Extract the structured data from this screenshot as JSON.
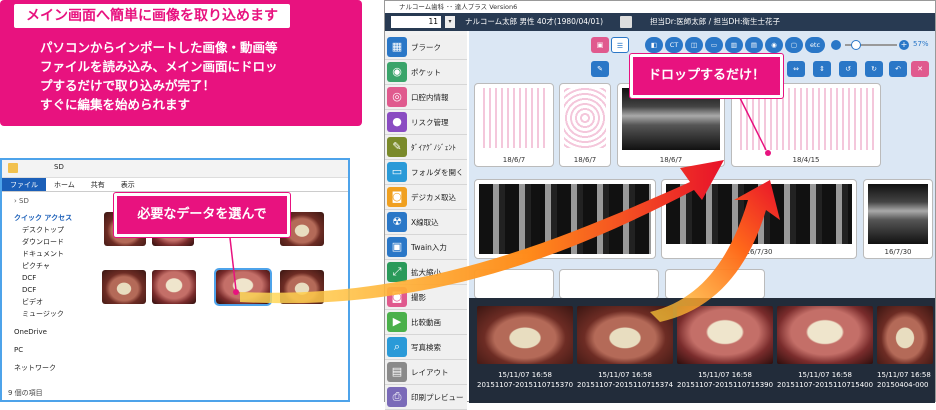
{
  "promo": {
    "title": "メイン画面へ簡単に画像を取り込めます",
    "lines": [
      "パソコンからインポートした画像・動画等",
      "ファイルを読み込み、メイン画面にドロッ",
      "プするだけで取り込みが完了！",
      "すぐに編集を始められます"
    ]
  },
  "explorer": {
    "title": "SD",
    "tabs": [
      "ファイル",
      "ホーム",
      "共有",
      "表示"
    ],
    "address": "SD",
    "nav": [
      "クイック アクセス",
      "デスクトップ",
      "ダウンロード",
      "ドキュメント",
      "ピクチャ",
      "DCF",
      "DCF",
      "ビデオ",
      "ミュージック",
      "OneDrive",
      "PC",
      "ネットワーク"
    ],
    "status": "9 個の項目"
  },
  "callouts": {
    "select": "必要なデータを選んで",
    "drop": "ドロップするだけ！"
  },
  "app": {
    "title": "ナルコーム歯科 ･･ 達人プラス Version6",
    "patient_id": "11",
    "patient_info": "ナルコーム太郎 男性 40才(1980/04/01)",
    "staff": "担当Dr:医師太郎 / 担当DH:衛生士花子",
    "zoom": "57%",
    "sidebar": [
      "ブラーク",
      "ポケット",
      "口腔内情報",
      "リスク管理",
      "ﾀﾞｲｱｸﾞﾉｼﾞｪﾝﾄ",
      "フォルダを開く",
      "デジカメ取込",
      "X線取込",
      "Twain入力",
      "拡大縮小",
      "撮影",
      "比較動画",
      "写真検索",
      "レイアウト",
      "印刷プレビュー"
    ],
    "toolbar": [
      "CT",
      "etc"
    ],
    "cards_row1": [
      "18/6/7",
      "18/6/7",
      "18/6/7",
      "18/4/15"
    ],
    "cards_row2": [
      "16/7/30",
      "16/7/30"
    ],
    "strip": [
      {
        "date": "15/11/07 16:58",
        "id": "20151107-2015110715370"
      },
      {
        "date": "15/11/07 16:58",
        "id": "20151107-2015110715374"
      },
      {
        "date": "15/11/07 16:58",
        "id": "20151107-2015110715390"
      },
      {
        "date": "15/11/07 16:58",
        "id": "20151107-2015110715400"
      },
      {
        "date": "15/11/07 16:58",
        "id": "20150404-000"
      }
    ]
  },
  "colors": {
    "accent": "#e8127f",
    "header": "#283a52",
    "blue": "#2a77c7"
  }
}
